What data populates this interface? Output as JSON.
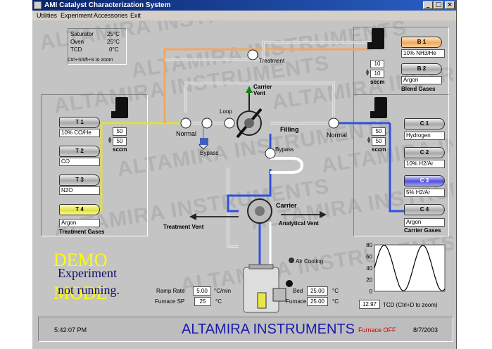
{
  "window": {
    "title": "AMI Catalyst Characterization System"
  },
  "menu": [
    "Utilities",
    "Experiment",
    "Accessories",
    "Exit"
  ],
  "readouts": {
    "saturator_label": "Saturator",
    "saturator_value": "25°C",
    "oven_label": "Oven",
    "oven_value": "25°C",
    "tcd_label": "TCD",
    "tcd_value": "0°C",
    "zoom_hint": "Ctrl+Shift+S to zoom"
  },
  "watermark": "ALTAMIRA INSTRUMENTS",
  "treatment_gases": {
    "title": "Treatment Gases",
    "tanks": [
      {
        "label": "T 1",
        "gas": "10% CO/He",
        "color": "gray"
      },
      {
        "label": "T 2",
        "gas": "CO",
        "color": "gray"
      },
      {
        "label": "T 3",
        "gas": "N2O",
        "color": "gray"
      },
      {
        "label": "T 4",
        "gas": "Argon",
        "color": "yellow"
      }
    ],
    "flow_setpoint": "50",
    "flow_actual": "50",
    "unit": "sccm"
  },
  "blend_gases": {
    "title": "Blend Gases",
    "tanks": [
      {
        "label": "B 1",
        "gas": "10% NH3/He",
        "color": "orange"
      },
      {
        "label": "B 2",
        "gas": "Argon",
        "color": "gray"
      }
    ],
    "flow_setpoint": "10",
    "flow_actual": "10",
    "unit": "sccm"
  },
  "carrier_gases": {
    "title": "Carrier Gases",
    "tanks": [
      {
        "label": "C 1",
        "gas": "Hydrogen",
        "color": "gray"
      },
      {
        "label": "C 2",
        "gas": "10% H2/Ar",
        "color": "gray"
      },
      {
        "label": "C 3",
        "gas": "5% H2/Ar",
        "color": "blue"
      },
      {
        "label": "C 4",
        "gas": "Argon",
        "color": "gray"
      }
    ],
    "flow_setpoint": "50",
    "flow_actual": "50",
    "unit": "sccm"
  },
  "flow_labels": {
    "treatment": "Treatment",
    "normal_left": "Normal",
    "normal_right": "Normal",
    "loop": "Loop",
    "bypass_left": "Bypass",
    "bypass_right": "Bypass",
    "carrier_vent": "Carrier\nVent",
    "filling": "Filling",
    "carrier": "Carrier",
    "treatment_vent": "Treatment Vent",
    "analytical_vent": "Analytical Vent",
    "air_cooling": "Air Cooling"
  },
  "demo": {
    "line1": "DEMO",
    "line2": "MODE",
    "status1": "Experiment",
    "status2": "not running."
  },
  "furnace": {
    "ramp_label": "Ramp Rate",
    "ramp_value": "5.00",
    "ramp_unit": "°C/min",
    "sp_label": "Furnace SP",
    "sp_value": "25",
    "sp_unit": "°C",
    "bed_label": "Bed",
    "bed_value": "25.00",
    "bed_unit": "°C",
    "furnace_label": "Furnace",
    "furnace_value": "25.00",
    "furnace_unit": "°C"
  },
  "chart_data": {
    "type": "line",
    "y_ticks": [
      "80",
      "60",
      "40",
      "20",
      "0"
    ],
    "ylim": [
      0,
      80
    ],
    "x": [
      0,
      1,
      2,
      3,
      4,
      5,
      6,
      7,
      8,
      9,
      10,
      11,
      12,
      13,
      14,
      15,
      16,
      17,
      18,
      19,
      20,
      21,
      22,
      23,
      24,
      25,
      26,
      27,
      28,
      29,
      30,
      31,
      32,
      33,
      34,
      35,
      36,
      37,
      38,
      39,
      40
    ],
    "values": [
      40,
      51,
      61,
      70,
      76,
      79,
      79,
      76,
      70,
      61,
      51,
      40,
      29,
      19,
      10,
      4,
      1,
      1,
      4,
      10,
      19,
      29,
      40,
      51,
      61,
      70,
      76,
      79,
      79,
      76,
      70,
      61,
      51,
      40,
      29,
      19,
      10,
      4,
      1,
      1,
      4
    ],
    "readout": "12.97",
    "readout_label": "TCD (Ctrl+D to zoom)",
    "line_color": "#000000"
  },
  "status_bar": {
    "time": "5:42:07 PM",
    "company": "ALTAMIRA INSTRUMENTS",
    "furnace_state": "Furnace OFF",
    "date": "8/7/2003"
  },
  "colors": {
    "treatment_line": "#e0e040",
    "blend_line": "#f0a860",
    "carrier_line": "#3050e0",
    "company_text": "#1a1ab0",
    "furnace_off": "#d00000",
    "demo_text": "#ffff00",
    "status_text": "#101060"
  }
}
